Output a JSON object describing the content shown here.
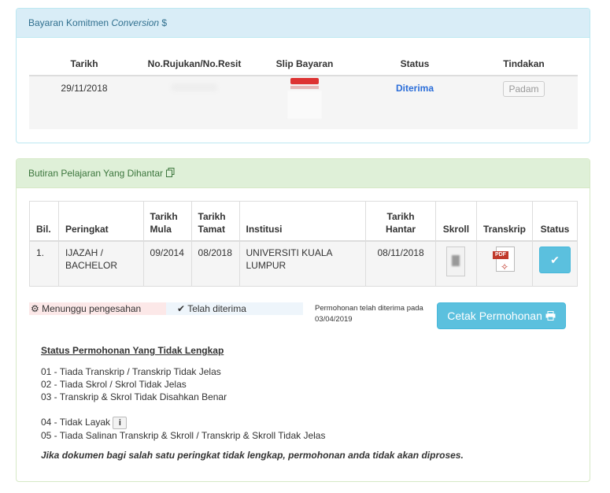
{
  "panel1": {
    "title_prefix": "Bayaran Komitmen ",
    "title_em": "Conversion",
    "title_suffix": " $",
    "headers": [
      "Tarikh",
      "No.Rujukan/No.Resit",
      "Slip Bayaran",
      "Status",
      "Tindakan"
    ],
    "row": {
      "tarikh": "29/11/2018",
      "status": "Diterima",
      "action": "Padam"
    }
  },
  "panel2": {
    "title": "Butiran Pelajaran Yang Dihantar",
    "headers": {
      "bil": "Bil.",
      "peringkat": "Peringkat",
      "tarikh_mula_1": "Tarikh",
      "tarikh_mula_2": "Mula",
      "tarikh_tamat_1": "Tarikh",
      "tarikh_tamat_2": "Tamat",
      "institusi": "Institusi",
      "tarikh_hantar_1": "Tarikh",
      "tarikh_hantar_2": "Hantar",
      "skroll": "Skroll",
      "transkrip": "Transkrip",
      "status": "Status"
    },
    "row": {
      "bil": "1.",
      "peringkat_1": "IJAZAH /",
      "peringkat_2": "BACHELOR",
      "mula": "09/2014",
      "tamat": "08/2018",
      "institusi_1": "UNIVERSITI KUALA",
      "institusi_2": "LUMPUR",
      "hantar": "08/11/2018"
    },
    "legend_pending": "Menunggu pengesahan",
    "legend_accepted": "Telah diterima",
    "accepted_note_1": "Permohonan telah diterima pada",
    "accepted_note_2": "03/04/2019",
    "print_button": "Cetak Permohonan",
    "status_title": "Status Permohonan Yang Tidak Lengkap",
    "reasons": [
      "01 - Tiada Transkrip / Transkrip Tidak Jelas",
      "02 - Tiada Skrol / Skrol Tidak Jelas",
      "03 - Transkrip & Skrol Tidak Disahkan Benar",
      "04 - Tidak Layak",
      "05 - Tiada Salinan Transkrip & Skroll / Transkrip & Skroll Tidak Jelas"
    ],
    "warning": "Jika dokumen bagi salah satu peringkat tidak lengkap, permohonan anda tidak akan diproses."
  },
  "icons": {
    "copy": "copy-icon",
    "gear": "gears-icon",
    "check": "check-icon",
    "print": "print-icon",
    "info": "info-icon",
    "pdf": "pdf-icon"
  }
}
